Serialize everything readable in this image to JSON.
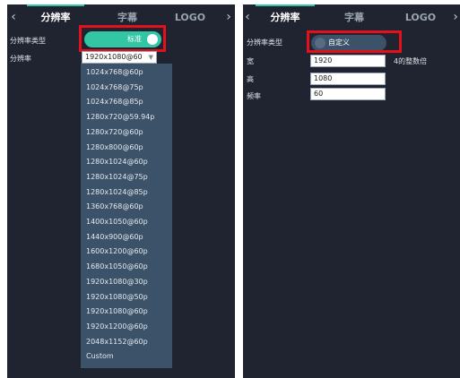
{
  "left_panel": {
    "tabs": [
      "分辨率",
      "字幕",
      "LOGO"
    ],
    "active_tab": 0,
    "resolution_type_label": "分辨率类型",
    "resolution_label": "分辨率",
    "toggle_text": "标准",
    "selected_value": "1920x1080@60",
    "dropdown_options": [
      "1024x768@60p",
      "1024x768@75p",
      "1024x768@85p",
      "1280x720@59.94p",
      "1280x720@60p",
      "1280x800@60p",
      "1280x1024@60p",
      "1280x1024@75p",
      "1280x1024@85p",
      "1360x768@60p",
      "1400x1050@60p",
      "1440x900@60p",
      "1600x1200@60p",
      "1680x1050@60p",
      "1920x1080@30p",
      "1920x1080@50p",
      "1920x1080@60p",
      "1920x1200@60p",
      "2048x1152@60p",
      "Custom"
    ]
  },
  "right_panel": {
    "tabs": [
      "分辨率",
      "字幕",
      "LOGO"
    ],
    "active_tab": 0,
    "resolution_type_label": "分辨率类型",
    "toggle_text": "自定义",
    "width_label": "宽",
    "width_value": "1920",
    "width_hint": "4的整数倍",
    "height_label": "高",
    "height_value": "1080",
    "rate_label": "频率",
    "rate_value": "60"
  },
  "colors": {
    "panel_bg": "#1f2430",
    "accent_green": "#33c6a5",
    "toggle_off": "#3c5268",
    "dropdown_bg": "#3c5268",
    "highlight_red": "#e4101a"
  },
  "icons": {
    "prev": "chevron-left-icon",
    "next": "chevron-right-icon",
    "dropdown": "chevron-down-icon"
  }
}
